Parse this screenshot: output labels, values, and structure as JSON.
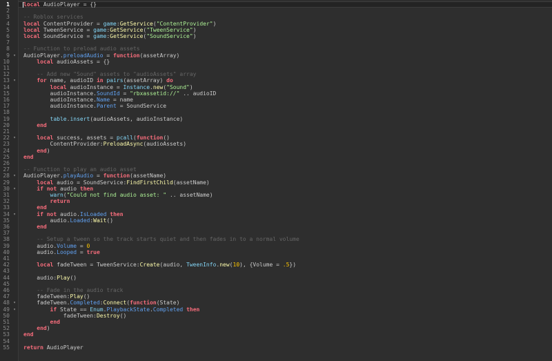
{
  "editor": {
    "active_line": 1,
    "lines": [
      {
        "n": "1",
        "fold": "",
        "tokens": [
          [
            "kw",
            "local"
          ],
          [
            "text",
            " AudioPlayer = {}"
          ]
        ]
      },
      {
        "n": "2",
        "fold": "",
        "tokens": []
      },
      {
        "n": "3",
        "fold": "",
        "tokens": [
          [
            "cmt",
            "-- Roblox services"
          ]
        ]
      },
      {
        "n": "4",
        "fold": "",
        "tokens": [
          [
            "kw",
            "local"
          ],
          [
            "text",
            " ContentProvider = "
          ],
          [
            "bi",
            "game"
          ],
          [
            "text",
            ":"
          ],
          [
            "fn",
            "GetService"
          ],
          [
            "text",
            "("
          ],
          [
            "str",
            "\"ContentProvider\""
          ],
          [
            "text",
            ")"
          ]
        ]
      },
      {
        "n": "5",
        "fold": "",
        "tokens": [
          [
            "kw",
            "local"
          ],
          [
            "text",
            " TweenService = "
          ],
          [
            "bi",
            "game"
          ],
          [
            "text",
            ":"
          ],
          [
            "fn",
            "GetService"
          ],
          [
            "text",
            "("
          ],
          [
            "str",
            "\"TweenService\""
          ],
          [
            "text",
            ")"
          ]
        ]
      },
      {
        "n": "6",
        "fold": "",
        "tokens": [
          [
            "kw",
            "local"
          ],
          [
            "text",
            " SoundService = "
          ],
          [
            "bi",
            "game"
          ],
          [
            "text",
            ":"
          ],
          [
            "fn",
            "GetService"
          ],
          [
            "text",
            "("
          ],
          [
            "str",
            "\"SoundService\""
          ],
          [
            "text",
            ")"
          ]
        ]
      },
      {
        "n": "7",
        "fold": "",
        "tokens": []
      },
      {
        "n": "8",
        "fold": "",
        "tokens": [
          [
            "cmt",
            "-- Function to preload audio assets"
          ]
        ]
      },
      {
        "n": "9",
        "fold": "v",
        "tokens": [
          [
            "text",
            "AudioPlayer."
          ],
          [
            "prop",
            "preloadAudio"
          ],
          [
            "text",
            " = "
          ],
          [
            "kw",
            "function"
          ],
          [
            "text",
            "(assetArray)"
          ]
        ]
      },
      {
        "n": "10",
        "fold": "",
        "tokens": [
          [
            "text",
            "    "
          ],
          [
            "kw",
            "local"
          ],
          [
            "text",
            " audioAssets = {}"
          ]
        ]
      },
      {
        "n": "11",
        "fold": "",
        "tokens": []
      },
      {
        "n": "12",
        "fold": "",
        "tokens": [
          [
            "text",
            "    "
          ],
          [
            "cmt",
            "-- Add new \"Sound\" assets to \"audioAssets\" array"
          ]
        ]
      },
      {
        "n": "13",
        "fold": "v",
        "tokens": [
          [
            "text",
            "    "
          ],
          [
            "kw",
            "for"
          ],
          [
            "text",
            " name, audioID "
          ],
          [
            "kw",
            "in"
          ],
          [
            "text",
            " "
          ],
          [
            "bi",
            "pairs"
          ],
          [
            "text",
            "(assetArray) "
          ],
          [
            "kw",
            "do"
          ]
        ]
      },
      {
        "n": "14",
        "fold": "",
        "tokens": [
          [
            "text",
            "        "
          ],
          [
            "kw",
            "local"
          ],
          [
            "text",
            " audioInstance = "
          ],
          [
            "bi",
            "Instance"
          ],
          [
            "text",
            "."
          ],
          [
            "fn",
            "new"
          ],
          [
            "text",
            "("
          ],
          [
            "str",
            "\"Sound\""
          ],
          [
            "text",
            ")"
          ]
        ]
      },
      {
        "n": "15",
        "fold": "",
        "tokens": [
          [
            "text",
            "        audioInstance."
          ],
          [
            "prop",
            "SoundId"
          ],
          [
            "text",
            " = "
          ],
          [
            "str",
            "\"rbxassetid://\""
          ],
          [
            "text",
            " .. audioID"
          ]
        ]
      },
      {
        "n": "16",
        "fold": "",
        "tokens": [
          [
            "text",
            "        audioInstance."
          ],
          [
            "prop",
            "Name"
          ],
          [
            "text",
            " = name"
          ]
        ]
      },
      {
        "n": "17",
        "fold": "",
        "tokens": [
          [
            "text",
            "        audioInstance."
          ],
          [
            "prop",
            "Parent"
          ],
          [
            "text",
            " = SoundService"
          ]
        ]
      },
      {
        "n": "18",
        "fold": "",
        "tokens": []
      },
      {
        "n": "19",
        "fold": "",
        "tokens": [
          [
            "text",
            "        "
          ],
          [
            "bi",
            "table"
          ],
          [
            "text",
            "."
          ],
          [
            "bi",
            "insert"
          ],
          [
            "text",
            "(audioAssets, audioInstance)"
          ]
        ]
      },
      {
        "n": "20",
        "fold": "",
        "tokens": [
          [
            "text",
            "    "
          ],
          [
            "kw",
            "end"
          ]
        ]
      },
      {
        "n": "21",
        "fold": "",
        "tokens": []
      },
      {
        "n": "22",
        "fold": "v",
        "tokens": [
          [
            "text",
            "    "
          ],
          [
            "kw",
            "local"
          ],
          [
            "text",
            " success, assets = "
          ],
          [
            "bi",
            "pcall"
          ],
          [
            "text",
            "("
          ],
          [
            "kw",
            "function"
          ],
          [
            "text",
            "()"
          ]
        ]
      },
      {
        "n": "23",
        "fold": "",
        "tokens": [
          [
            "text",
            "        ContentProvider:"
          ],
          [
            "fn",
            "PreloadAsync"
          ],
          [
            "text",
            "(audioAssets)"
          ]
        ]
      },
      {
        "n": "24",
        "fold": "",
        "tokens": [
          [
            "text",
            "    "
          ],
          [
            "kw",
            "end"
          ],
          [
            "text",
            ")"
          ]
        ]
      },
      {
        "n": "25",
        "fold": "",
        "tokens": [
          [
            "kw",
            "end"
          ]
        ]
      },
      {
        "n": "26",
        "fold": "",
        "tokens": []
      },
      {
        "n": "27",
        "fold": "",
        "tokens": [
          [
            "cmt",
            "-- Function to play an audio asset"
          ]
        ]
      },
      {
        "n": "28",
        "fold": "v",
        "tokens": [
          [
            "text",
            "AudioPlayer."
          ],
          [
            "prop",
            "playAudio"
          ],
          [
            "text",
            " = "
          ],
          [
            "kw",
            "function"
          ],
          [
            "text",
            "(assetName)"
          ]
        ]
      },
      {
        "n": "29",
        "fold": "",
        "tokens": [
          [
            "text",
            "    "
          ],
          [
            "kw",
            "local"
          ],
          [
            "text",
            " audio = SoundService:"
          ],
          [
            "fn",
            "FindFirstChild"
          ],
          [
            "text",
            "(assetName)"
          ]
        ]
      },
      {
        "n": "30",
        "fold": "v",
        "tokens": [
          [
            "text",
            "    "
          ],
          [
            "kw",
            "if"
          ],
          [
            "text",
            " "
          ],
          [
            "kw",
            "not"
          ],
          [
            "text",
            " audio "
          ],
          [
            "kw",
            "then"
          ]
        ]
      },
      {
        "n": "31",
        "fold": "",
        "tokens": [
          [
            "text",
            "        "
          ],
          [
            "bi",
            "warn"
          ],
          [
            "text",
            "("
          ],
          [
            "str",
            "\"Could not find audio asset: \""
          ],
          [
            "text",
            " .. assetName)"
          ]
        ]
      },
      {
        "n": "32",
        "fold": "",
        "tokens": [
          [
            "text",
            "        "
          ],
          [
            "kw",
            "return"
          ]
        ]
      },
      {
        "n": "33",
        "fold": "",
        "tokens": [
          [
            "text",
            "    "
          ],
          [
            "kw",
            "end"
          ]
        ]
      },
      {
        "n": "34",
        "fold": "v",
        "tokens": [
          [
            "text",
            "    "
          ],
          [
            "kw",
            "if"
          ],
          [
            "text",
            " "
          ],
          [
            "kw",
            "not"
          ],
          [
            "text",
            " audio."
          ],
          [
            "prop",
            "IsLoaded"
          ],
          [
            "text",
            " "
          ],
          [
            "kw",
            "then"
          ]
        ]
      },
      {
        "n": "35",
        "fold": "",
        "tokens": [
          [
            "text",
            "        audio."
          ],
          [
            "prop",
            "Loaded"
          ],
          [
            "text",
            ":"
          ],
          [
            "fn",
            "Wait"
          ],
          [
            "text",
            "()"
          ]
        ]
      },
      {
        "n": "36",
        "fold": "",
        "tokens": [
          [
            "text",
            "    "
          ],
          [
            "kw",
            "end"
          ]
        ]
      },
      {
        "n": "37",
        "fold": "",
        "tokens": []
      },
      {
        "n": "38",
        "fold": "",
        "tokens": [
          [
            "text",
            "    "
          ],
          [
            "cmt",
            "-- Setup a tween so the track starts quiet and then fades in to a normal volume"
          ]
        ]
      },
      {
        "n": "39",
        "fold": "",
        "tokens": [
          [
            "text",
            "    audio."
          ],
          [
            "prop",
            "Volume"
          ],
          [
            "text",
            " = "
          ],
          [
            "num",
            "0"
          ]
        ]
      },
      {
        "n": "40",
        "fold": "",
        "tokens": [
          [
            "text",
            "    audio."
          ],
          [
            "prop",
            "Looped"
          ],
          [
            "text",
            " = "
          ],
          [
            "kw",
            "true"
          ]
        ]
      },
      {
        "n": "41",
        "fold": "",
        "tokens": []
      },
      {
        "n": "42",
        "fold": "",
        "tokens": [
          [
            "text",
            "    "
          ],
          [
            "kw",
            "local"
          ],
          [
            "text",
            " fadeTween = TweenService:"
          ],
          [
            "fn",
            "Create"
          ],
          [
            "text",
            "(audio, "
          ],
          [
            "bi",
            "TweenInfo"
          ],
          [
            "text",
            "."
          ],
          [
            "fn",
            "new"
          ],
          [
            "text",
            "("
          ],
          [
            "num",
            "10"
          ],
          [
            "text",
            "), {Volume = "
          ],
          [
            "num",
            ".5"
          ],
          [
            "text",
            "})"
          ]
        ]
      },
      {
        "n": "43",
        "fold": "",
        "tokens": []
      },
      {
        "n": "44",
        "fold": "",
        "tokens": [
          [
            "text",
            "    audio:"
          ],
          [
            "fn",
            "Play"
          ],
          [
            "text",
            "()"
          ]
        ]
      },
      {
        "n": "45",
        "fold": "",
        "tokens": []
      },
      {
        "n": "46",
        "fold": "",
        "tokens": [
          [
            "text",
            "    "
          ],
          [
            "cmt",
            "-- Fade in the audio track"
          ]
        ]
      },
      {
        "n": "47",
        "fold": "",
        "tokens": [
          [
            "text",
            "    fadeTween:"
          ],
          [
            "fn",
            "Play"
          ],
          [
            "text",
            "()"
          ]
        ]
      },
      {
        "n": "48",
        "fold": "v",
        "tokens": [
          [
            "text",
            "    fadeTween."
          ],
          [
            "prop",
            "Completed"
          ],
          [
            "text",
            ":"
          ],
          [
            "fn",
            "Connect"
          ],
          [
            "text",
            "("
          ],
          [
            "kw",
            "function"
          ],
          [
            "text",
            "(State)"
          ]
        ]
      },
      {
        "n": "49",
        "fold": "v",
        "tokens": [
          [
            "text",
            "        "
          ],
          [
            "kw",
            "if"
          ],
          [
            "text",
            " State == "
          ],
          [
            "bi",
            "Enum"
          ],
          [
            "text",
            "."
          ],
          [
            "prop",
            "PlaybackState"
          ],
          [
            "text",
            "."
          ],
          [
            "prop",
            "Completed"
          ],
          [
            "text",
            " "
          ],
          [
            "kw",
            "then"
          ]
        ]
      },
      {
        "n": "50",
        "fold": "",
        "tokens": [
          [
            "text",
            "            fadeTween:"
          ],
          [
            "fn",
            "Destroy"
          ],
          [
            "text",
            "()"
          ]
        ]
      },
      {
        "n": "51",
        "fold": "",
        "tokens": [
          [
            "text",
            "        "
          ],
          [
            "kw",
            "end"
          ]
        ]
      },
      {
        "n": "52",
        "fold": "",
        "tokens": [
          [
            "text",
            "    "
          ],
          [
            "kw",
            "end"
          ],
          [
            "text",
            ")"
          ]
        ]
      },
      {
        "n": "53",
        "fold": "",
        "tokens": [
          [
            "kw",
            "end"
          ]
        ]
      },
      {
        "n": "54",
        "fold": "",
        "tokens": []
      },
      {
        "n": "55",
        "fold": "",
        "tokens": [
          [
            "kw",
            "return"
          ],
          [
            "text",
            " AudioPlayer"
          ]
        ]
      }
    ]
  }
}
